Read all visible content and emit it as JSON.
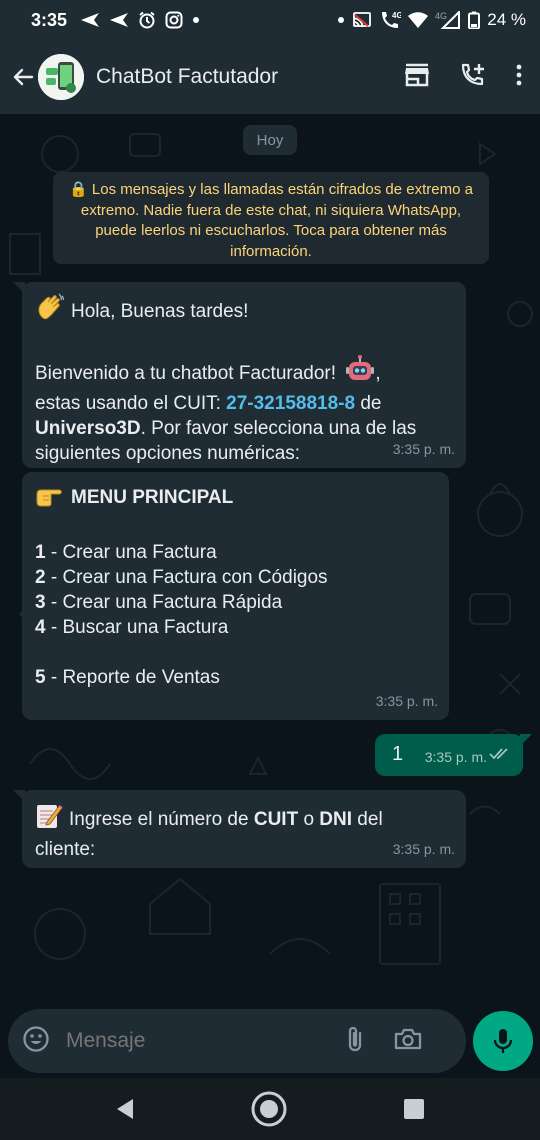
{
  "status_bar": {
    "time": "3:35",
    "network_label": "4G",
    "network_label_2": "4G",
    "battery": "24 %"
  },
  "header": {
    "title": "ChatBot Factutador"
  },
  "chat": {
    "date_chip": "Hoy",
    "system_notice": "🔒 Los mensajes y las llamadas están cifrados de extremo a extremo. Nadie fuera de este chat, ni siquiera WhatsApp, puede leerlos ni escucharlos. Toca para obtener más información.",
    "messages": [
      {
        "greeting": "Hola, Buenas tardes!",
        "line1": "Bienvenido a tu chatbot Facturador!",
        "line2_pre": "estas usando el CUIT: ",
        "cuit": "27-32158818-8",
        "line2_post": " de",
        "company": "Universo3D",
        "line3_post": ". Por favor selecciona una de las",
        "line4": "siguientes opciones numéricas:",
        "time": "3:35 p. m."
      },
      {
        "menu_title": "MENU PRINCIPAL",
        "options": [
          {
            "num": "1",
            "text": " - Crear una Factura"
          },
          {
            "num": "2",
            "text": " - Crear una Factura con Códigos"
          },
          {
            "num": "3",
            "text": " - Crear una Factura Rápida"
          },
          {
            "num": "4",
            "text": " - Buscar una Factura"
          },
          {
            "num": "5",
            "text": " - Reporte de Ventas"
          }
        ],
        "time": "3:35 p. m."
      },
      {
        "text": "1",
        "time": "3:35 p. m.",
        "status": "read"
      },
      {
        "pre": "Ingrese el número de ",
        "cuit": "CUIT",
        "mid": " o ",
        "dni": "DNI",
        "post": " del",
        "line2": "cliente:",
        "time": "3:35 p. m."
      }
    ]
  },
  "input": {
    "placeholder": "Mensaje"
  },
  "colors": {
    "background": "#0b141a",
    "bar": "#1f2c34",
    "incoming_bubble": "#202c33",
    "outgoing_bubble": "#005c4b",
    "accent": "#00a884",
    "link": "#53bdeb",
    "notice_text": "#ffd279"
  }
}
